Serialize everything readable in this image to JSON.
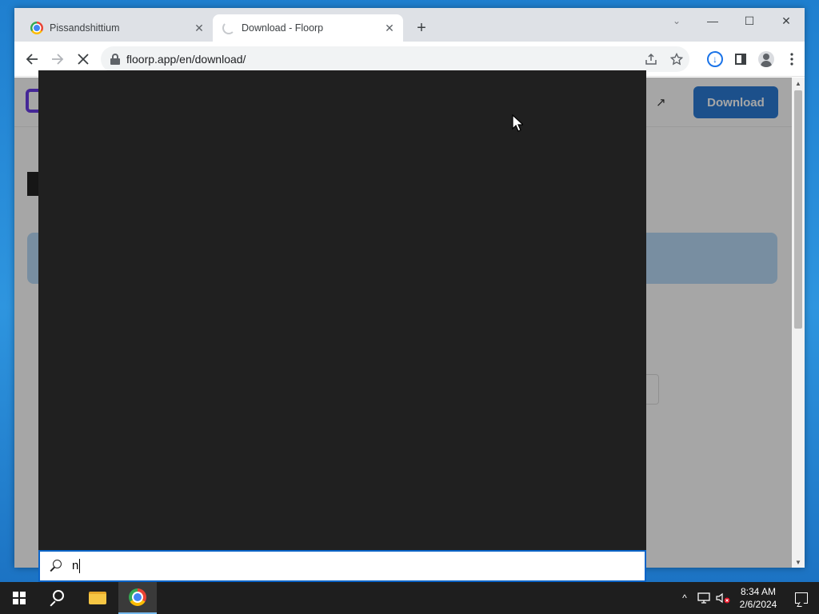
{
  "browser": {
    "tabs": [
      {
        "title": "Pissandshittium",
        "close": "✕"
      },
      {
        "title": "Download - Floorp",
        "close": "✕"
      }
    ],
    "new_tab": "+",
    "address": {
      "url": "floorp.app/en/download/"
    },
    "window_controls": {
      "minimize": "—",
      "maximize": "☐",
      "close": "✕",
      "tab_search": "⌄"
    }
  },
  "page": {
    "download_button": "Download",
    "external_link_icon": "↗"
  },
  "start_search": {
    "query": "n"
  },
  "taskbar": {
    "clock": {
      "time": "8:34 AM",
      "date": "2/6/2024"
    },
    "tray_chevron": "^"
  },
  "colors": {
    "accent_blue": "#2b7bd6",
    "search_panel_bg": "#202020",
    "taskbar_bg": "#1e1e1e"
  }
}
